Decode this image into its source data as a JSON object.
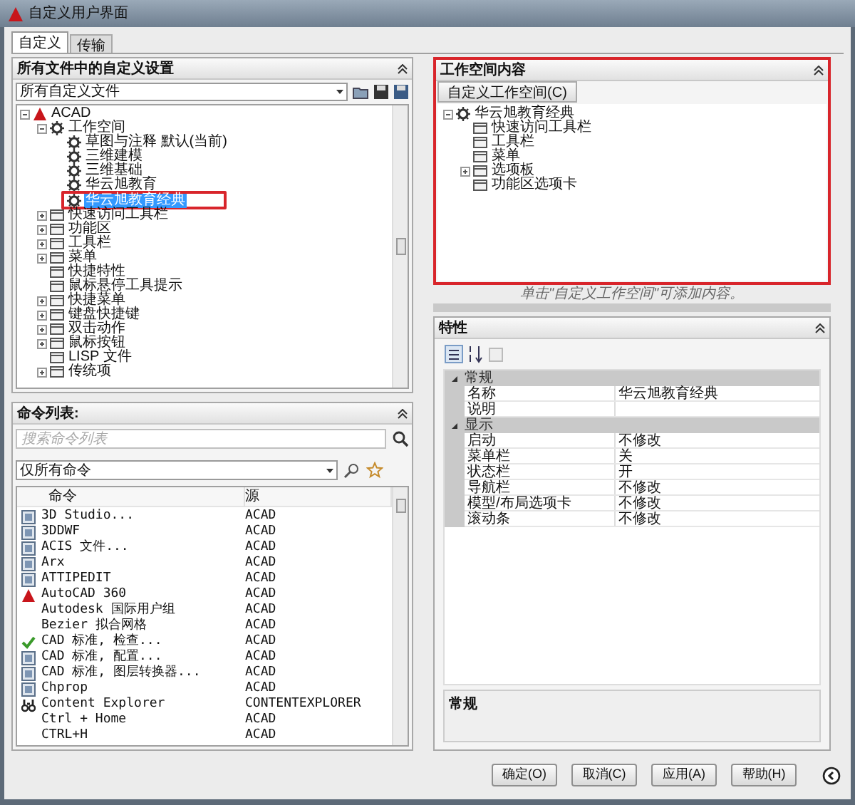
{
  "window": {
    "title": "自定义用户界面"
  },
  "tabs": [
    {
      "label": "自定义",
      "selected": true
    },
    {
      "label": "传输",
      "selected": false
    }
  ],
  "customizations_panel": {
    "title": "所有文件中的自定义设置",
    "file_dropdown": "所有自定义文件",
    "tree": [
      {
        "label": "ACAD",
        "kind": "file",
        "expanded": true,
        "children": [
          {
            "label": "工作空间",
            "kind": "workspace",
            "expanded": true,
            "children": [
              {
                "label": "草图与注释 默认(当前)",
                "kind": "workspace",
                "selected": false,
                "highlighted": false
              },
              {
                "label": "三维建模",
                "kind": "workspace",
                "selected": false,
                "highlighted": false
              },
              {
                "label": "三维基础",
                "kind": "workspace",
                "selected": false,
                "highlighted": false
              },
              {
                "label": "华云旭教育",
                "kind": "workspace",
                "selected": false,
                "highlighted": false
              },
              {
                "label": "华云旭教育经典",
                "kind": "workspace",
                "selected": true,
                "highlighted": true
              }
            ]
          },
          {
            "label": "快速访问工具栏",
            "kind": "element",
            "expanded": false
          },
          {
            "label": "功能区",
            "kind": "element",
            "expanded": false
          },
          {
            "label": "工具栏",
            "kind": "element",
            "expanded": false
          },
          {
            "label": "菜单",
            "kind": "element",
            "expanded": false
          },
          {
            "label": "快捷特性",
            "kind": "element"
          },
          {
            "label": "鼠标悬停工具提示",
            "kind": "element"
          },
          {
            "label": "快捷菜单",
            "kind": "element",
            "expanded": false
          },
          {
            "label": "键盘快捷键",
            "kind": "element",
            "expanded": false
          },
          {
            "label": "双击动作",
            "kind": "element",
            "expanded": false
          },
          {
            "label": "鼠标按钮",
            "kind": "element",
            "expanded": false
          },
          {
            "label": "LISP 文件",
            "kind": "element"
          },
          {
            "label": "传统项",
            "kind": "element",
            "expanded": false
          }
        ]
      }
    ]
  },
  "command_panel": {
    "title": "命令列表:",
    "search": {
      "placeholder": "搜索命令列表"
    },
    "filter_dropdown": "仅所有命令",
    "columns": [
      "命令",
      "源"
    ],
    "rows": [
      {
        "command": "3D Studio...",
        "source": "ACAD",
        "kind": "tool"
      },
      {
        "command": "3DDWF",
        "source": "ACAD",
        "kind": "tool"
      },
      {
        "command": "ACIS 文件...",
        "source": "ACAD",
        "kind": "tool"
      },
      {
        "command": "Arx",
        "source": "ACAD",
        "kind": "tool"
      },
      {
        "command": "ATTIPEDIT",
        "source": "ACAD",
        "kind": "tool"
      },
      {
        "command": "AutoCAD 360",
        "source": "ACAD",
        "kind": "app"
      },
      {
        "command": "Autodesk 国际用户组",
        "source": "ACAD",
        "kind": "plain"
      },
      {
        "command": "Bezier 拟合网格",
        "source": "ACAD",
        "kind": "plain"
      },
      {
        "command": "CAD 标准, 检查...",
        "source": "ACAD",
        "kind": "check"
      },
      {
        "command": "CAD 标准, 配置...",
        "source": "ACAD",
        "kind": "tool"
      },
      {
        "command": "CAD 标准, 图层转换器...",
        "source": "ACAD",
        "kind": "tool"
      },
      {
        "command": "Chprop",
        "source": "ACAD",
        "kind": "tool"
      },
      {
        "command": "Content Explorer",
        "source": "CONTENTEXPLORER",
        "kind": "binoculars"
      },
      {
        "command": "Ctrl + Home",
        "source": "ACAD",
        "kind": "plain"
      },
      {
        "command": "CTRL+H",
        "source": "ACAD",
        "kind": "plain"
      }
    ]
  },
  "workspace_panel": {
    "title": "工作空间内容",
    "highlighted": true,
    "customize_button": "自定义工作空间(C)",
    "tree": [
      {
        "label": "华云旭教育经典",
        "kind": "workspace",
        "expanded": true,
        "children": [
          {
            "label": "快速访问工具栏",
            "kind": "element"
          },
          {
            "label": "工具栏",
            "kind": "element"
          },
          {
            "label": "菜单",
            "kind": "element"
          },
          {
            "label": "选项板",
            "kind": "element",
            "expanded": false
          },
          {
            "label": "功能区选项卡",
            "kind": "element"
          }
        ]
      }
    ],
    "hint": "单击\"自定义工作空间\"可添加内容。"
  },
  "properties_panel": {
    "title": "特性",
    "categories": [
      {
        "name": "常规",
        "expanded": true,
        "rows": [
          {
            "name": "名称",
            "value": "华云旭教育经典"
          },
          {
            "name": "说明"
          }
        ]
      },
      {
        "name": "显示",
        "expanded": true,
        "rows": [
          {
            "name": "启动",
            "value": "不修改"
          },
          {
            "name": "菜单栏",
            "value": "关"
          },
          {
            "name": "状态栏",
            "value": "开"
          },
          {
            "name": "导航栏",
            "value": "不修改"
          },
          {
            "name": "模型/布局选项卡",
            "value": "不修改"
          },
          {
            "name": "滚动条",
            "value": "不修改"
          }
        ]
      }
    ],
    "description_title": "常规"
  },
  "buttons": [
    "确定(O)",
    "取消(C)",
    "应用(A)",
    "帮助(H)"
  ]
}
